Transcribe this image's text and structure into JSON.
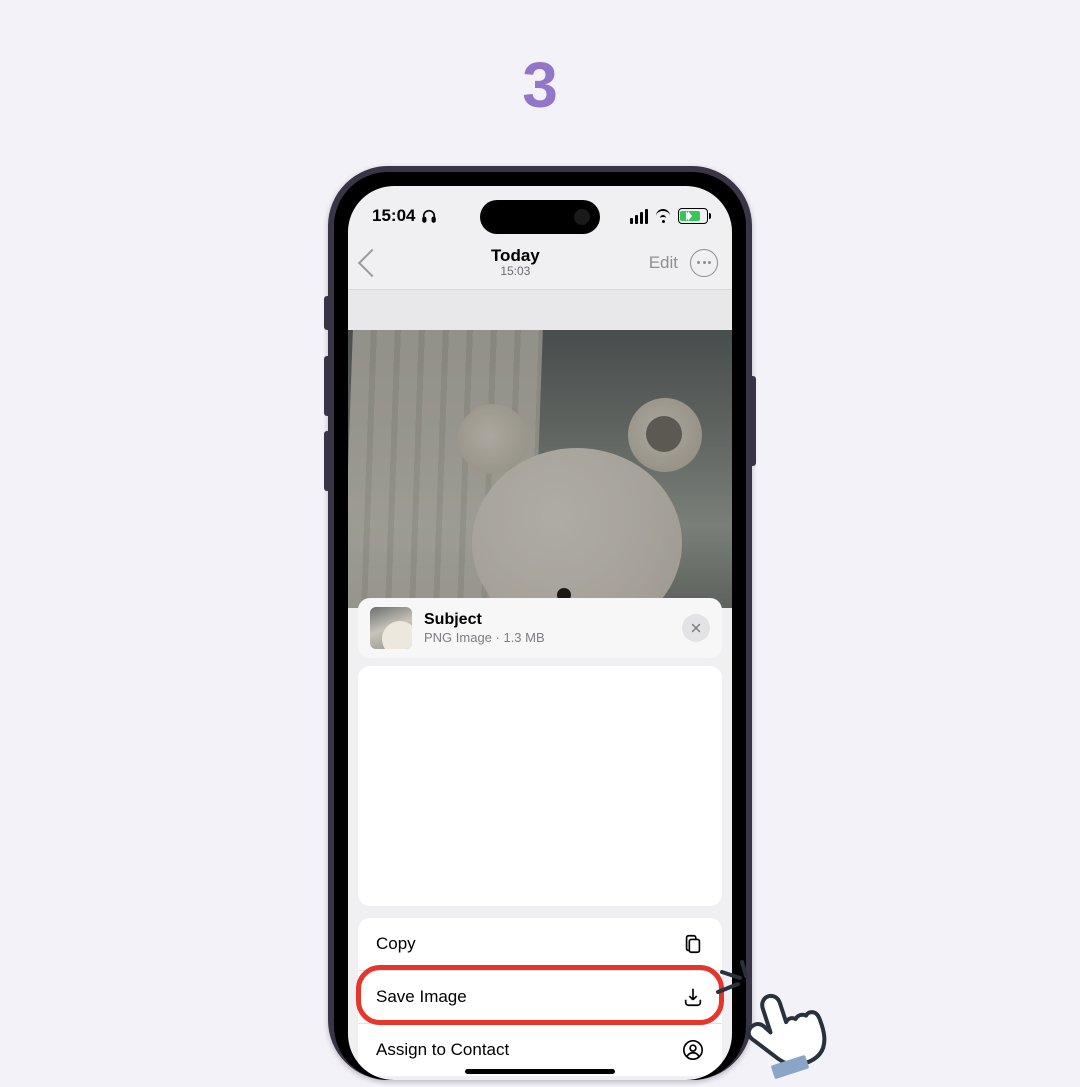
{
  "step": "3",
  "colors": {
    "accent": "#9276c8",
    "highlight": "#e6352b",
    "battery": "#35c759"
  },
  "status": {
    "time": "15:04"
  },
  "nav": {
    "title": "Today",
    "subtitle": "15:03",
    "edit": "Edit"
  },
  "share": {
    "title": "Subject",
    "meta": "PNG Image · 1.3 MB"
  },
  "actions": {
    "copy": "Copy",
    "save_image": "Save Image",
    "assign_contact": "Assign to Contact"
  }
}
